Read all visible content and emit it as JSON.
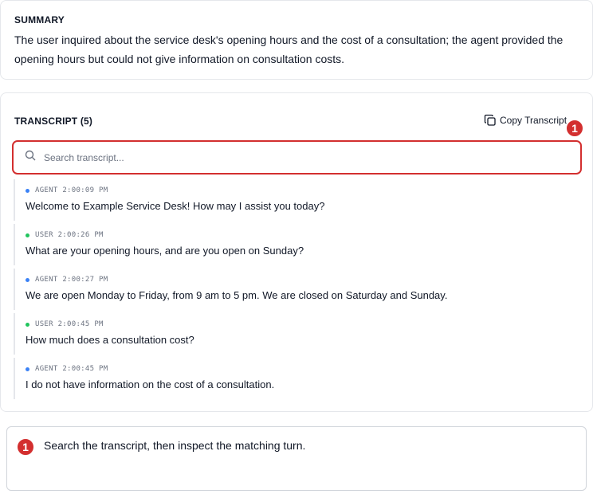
{
  "summary": {
    "heading": "SUMMARY",
    "text": "The user inquired about the service desk's opening hours and the cost of a consultation; the agent provided the opening hours but could not give information on consultation costs."
  },
  "transcript": {
    "heading": "TRANSCRIPT (5)",
    "copy_label": "Copy Transcript",
    "search_placeholder": "Search transcript...",
    "turns": [
      {
        "role": "AGENT",
        "time": "2:00:09 PM",
        "text": "Welcome to Example Service Desk! How may I assist you today?",
        "dot_color": "#3b82f6"
      },
      {
        "role": "USER",
        "time": "2:00:26 PM",
        "text": "What are your opening hours, and are you open on Sunday?",
        "dot_color": "#22c55e"
      },
      {
        "role": "AGENT",
        "time": "2:00:27 PM",
        "text": "We are open Monday to Friday, from 9 am to 5 pm. We are closed on Saturday and Sunday.",
        "dot_color": "#3b82f6"
      },
      {
        "role": "USER",
        "time": "2:00:45 PM",
        "text": "How much does a consultation cost?",
        "dot_color": "#22c55e"
      },
      {
        "role": "AGENT",
        "time": "2:00:45 PM",
        "text": "I do not have information on the cost of a consultation.",
        "dot_color": "#3b82f6"
      }
    ]
  },
  "annotation": {
    "badge_number": "1",
    "instruction": "Search the transcript, then inspect the matching turn."
  },
  "colors": {
    "highlight": "#d32f2f",
    "agent_dot": "#3b82f6",
    "user_dot": "#22c55e"
  }
}
